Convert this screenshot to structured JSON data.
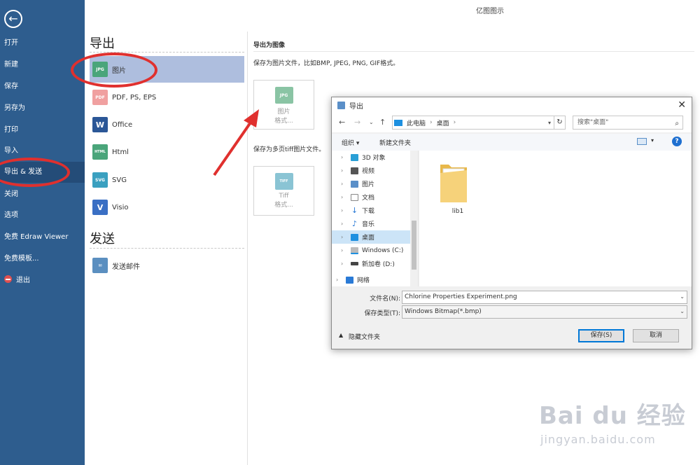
{
  "app_title": "亿图图示",
  "sidebar": {
    "items": [
      {
        "label": "打开"
      },
      {
        "label": "新建"
      },
      {
        "label": "保存"
      },
      {
        "label": "另存为"
      },
      {
        "label": "打印"
      },
      {
        "label": "导入"
      },
      {
        "label": "导出 & 发送",
        "active": true
      },
      {
        "label": "关闭"
      },
      {
        "label": "选项"
      },
      {
        "label": "免费 Edraw Viewer"
      },
      {
        "label": "免费模板..."
      },
      {
        "label": "退出"
      }
    ]
  },
  "export": {
    "title": "导出",
    "formats": [
      {
        "label": "图片",
        "icon": "jpg-icon",
        "icon_text": "JPG",
        "color": "#4aa57a",
        "active": true
      },
      {
        "label": "PDF, PS, EPS",
        "icon": "pdf-icon",
        "icon_text": "PDF",
        "color": "#f0a0a0"
      },
      {
        "label": "Office",
        "icon": "word-icon",
        "icon_text": "W",
        "color": "#2b5797"
      },
      {
        "label": "Html",
        "icon": "html-icon",
        "icon_text": "HTML",
        "color": "#4aa57a"
      },
      {
        "label": "SVG",
        "icon": "svg-icon",
        "icon_text": "SVG",
        "color": "#3aa0c0"
      },
      {
        "label": "Visio",
        "icon": "visio-icon",
        "icon_text": "V",
        "color": "#3a6fc4"
      }
    ]
  },
  "send": {
    "title": "发送",
    "items": [
      {
        "label": "发送邮件",
        "icon": "email-icon"
      }
    ]
  },
  "right_panel": {
    "title": "导出为图像",
    "desc1": "保存为图片文件，比如BMP, JPEG, PNG, GIF格式。",
    "tile1": {
      "line1": "图片",
      "line2": "格式...",
      "icon_text": "JPG"
    },
    "desc2": "保存为多页tiff图片文件。",
    "tile2": {
      "line1": "Tiff",
      "line2": "格式...",
      "icon_text": "TIFF"
    }
  },
  "dialog": {
    "title": "导出",
    "path": [
      "此电脑",
      "桌面"
    ],
    "search_placeholder": "搜索\"桌面\"",
    "toolbar": {
      "organize": "组织 ▾",
      "new_folder": "新建文件夹"
    },
    "tree": [
      {
        "label": "3D 对象",
        "icon_color": "#2a9fd6"
      },
      {
        "label": "视频",
        "icon_color": "#555"
      },
      {
        "label": "图片",
        "icon_color": "#5a8fc8"
      },
      {
        "label": "文档",
        "icon_color": "#888"
      },
      {
        "label": "下载",
        "icon_color": "#2a7ad6"
      },
      {
        "label": "音乐",
        "icon_color": "#2a7ad6"
      },
      {
        "label": "桌面",
        "icon_color": "#1e90e0",
        "selected": true
      },
      {
        "label": "Windows (C:)",
        "icon_color": "#777"
      },
      {
        "label": "新加卷 (D:)",
        "icon_color": "#444"
      },
      {
        "label": "网络",
        "icon_color": "#2a7ad6"
      }
    ],
    "files": [
      {
        "name": "lib1"
      }
    ],
    "filename_label": "文件名(N):",
    "filename_value": "Chlorine Properties Experiment.png",
    "filetype_label": "保存类型(T):",
    "filetype_value": "Windows Bitmap(*.bmp)",
    "hide_folders": "隐藏文件夹",
    "save_button": "保存(S)",
    "cancel_button": "取消"
  },
  "watermark": {
    "brand": "Bai du 经验",
    "url": "jingyan.baidu.com"
  },
  "colors": {
    "sidebar_bg": "#2e5d8e",
    "active_format_bg": "#aebede",
    "annotation_red": "#e0302e"
  }
}
